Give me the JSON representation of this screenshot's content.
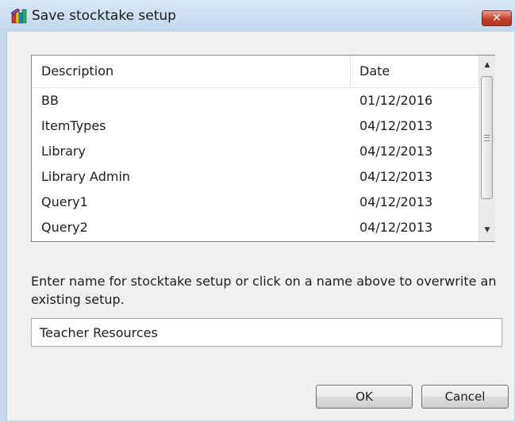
{
  "window": {
    "title": "Save stocktake setup",
    "close_label": "✕",
    "icon": "stocktake-app-icon"
  },
  "list": {
    "columns": [
      "Description",
      "Date"
    ],
    "rows": [
      {
        "description": "BB",
        "date": "01/12/2016"
      },
      {
        "description": "ItemTypes",
        "date": "04/12/2013"
      },
      {
        "description": "Library",
        "date": "04/12/2013"
      },
      {
        "description": "Library Admin",
        "date": "04/12/2013"
      },
      {
        "description": "Query1",
        "date": "04/12/2013"
      },
      {
        "description": "Query2",
        "date": "04/12/2013"
      }
    ]
  },
  "prompt": {
    "text": "Enter name for stocktake setup or click on a name above to overwrite an existing setup."
  },
  "name_input": {
    "value": "Teacher Resources"
  },
  "buttons": {
    "ok_label": "OK",
    "cancel_label": "Cancel"
  }
}
